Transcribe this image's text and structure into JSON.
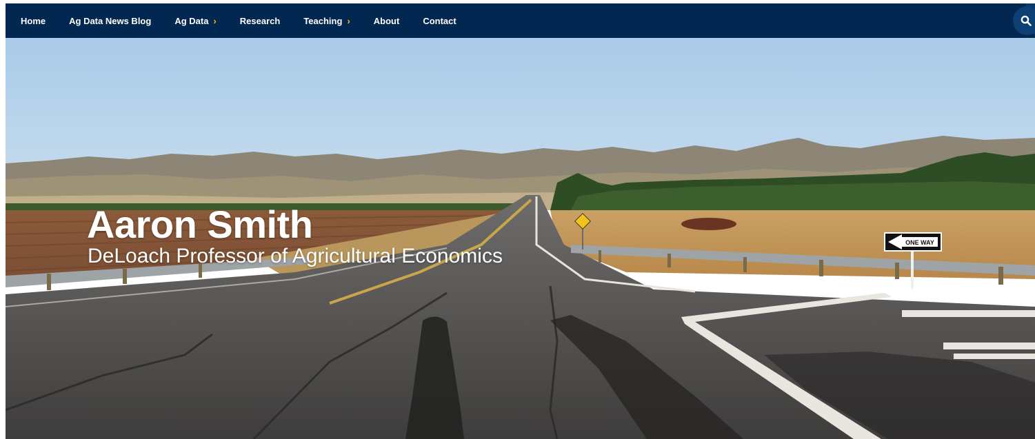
{
  "nav": {
    "items": [
      {
        "label": "Home",
        "has_submenu": false
      },
      {
        "label": "Ag Data News Blog",
        "has_submenu": false
      },
      {
        "label": "Ag Data",
        "has_submenu": true
      },
      {
        "label": "Research",
        "has_submenu": false
      },
      {
        "label": "Teaching",
        "has_submenu": true
      },
      {
        "label": "About",
        "has_submenu": false
      },
      {
        "label": "Contact",
        "has_submenu": false
      }
    ],
    "submenu_icon": "chevron-right-icon",
    "search_icon": "search-icon"
  },
  "hero": {
    "title": "Aaron Smith",
    "subtitle": "DeLoach Professor of Agricultural Economics",
    "sign_text": "ONE WAY"
  },
  "colors": {
    "nav_background": "#022851",
    "submenu_chevron": "#ffbf00",
    "hero_text": "#ffffff"
  }
}
